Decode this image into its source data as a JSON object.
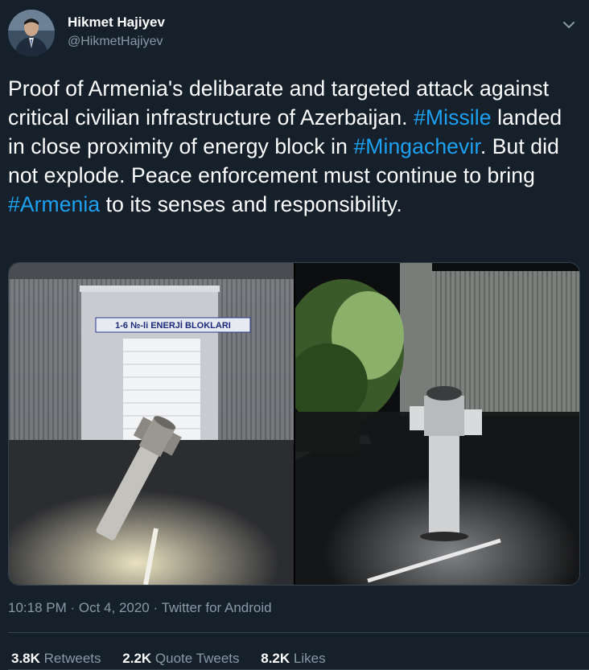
{
  "author": {
    "name": "Hikmet Hajiyev",
    "handle": "@HikmetHajiyev"
  },
  "tweet": {
    "segments": [
      {
        "text": "Proof of Armenia's delibarate and targeted attack against critical civilian infrastructure of Azerbaijan. ",
        "hashtag": false
      },
      {
        "text": "#Missile",
        "hashtag": true
      },
      {
        "text": " landed in close proximity of energy block in ",
        "hashtag": false
      },
      {
        "text": "#Mingachevir",
        "hashtag": true
      },
      {
        "text": ". But did not explode. Peace enforcement must continue to bring ",
        "hashtag": false
      },
      {
        "text": "#Armenia",
        "hashtag": true
      },
      {
        "text": " to its senses and responsibility.",
        "hashtag": false
      }
    ]
  },
  "media": {
    "left_sign_text": "1-6 №-li ENERJİ BLOKLARI"
  },
  "meta": {
    "time": "10:18 PM",
    "date": "Oct 4, 2020",
    "source": "Twitter for Android",
    "separator": " · "
  },
  "stats": {
    "retweets_count": "3.8K",
    "retweets_label": "Retweets",
    "quotes_count": "2.2K",
    "quotes_label": "Quote Tweets",
    "likes_count": "8.2K",
    "likes_label": "Likes"
  },
  "icons": {
    "caret": "chevron-down-icon"
  },
  "colors": {
    "background": "#15202b",
    "hashtag": "#1da1f2",
    "secondary_text": "#8899a6",
    "divider": "#38444d"
  }
}
